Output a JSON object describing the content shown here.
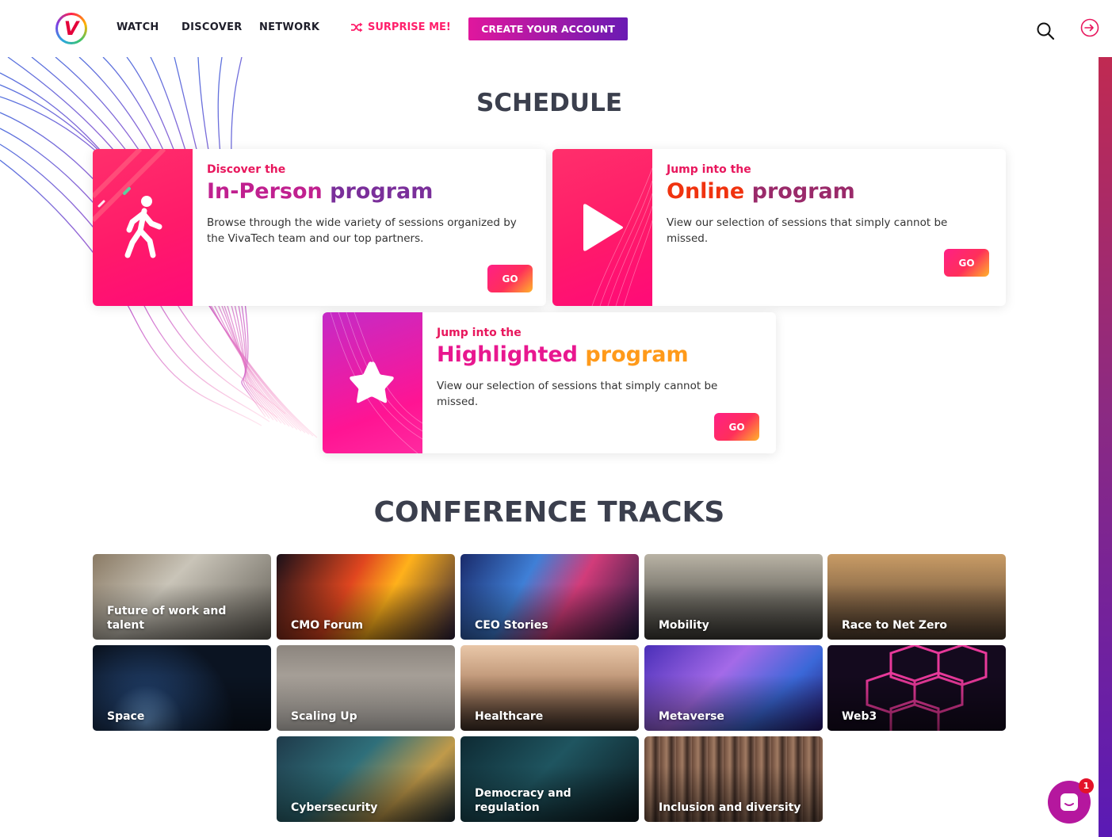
{
  "header": {
    "logo_letter": "V",
    "nav": [
      "WATCH",
      "DISCOVER",
      "NETWORK"
    ],
    "surprise_label": "SURPRISE ME!",
    "create_account_label": "CREATE YOUR ACCOUNT"
  },
  "schedule": {
    "title": "SCHEDULE",
    "cards": [
      {
        "kicker": "Discover the",
        "title_word1": "In-Person",
        "title_word2": "program",
        "description": "Browse through the wide variety of sessions organized by the VivaTech team and our top partners.",
        "button": "GO"
      },
      {
        "kicker": "Jump into the",
        "title_word1": "Online",
        "title_word2": "program",
        "description": "View our selection of sessions that simply cannot be missed.",
        "button": "GO"
      },
      {
        "kicker": "Jump into the",
        "title_word1": "Highlighted",
        "title_word2": "program",
        "description": "View our selection of sessions that simply cannot be missed.",
        "button": "GO"
      }
    ]
  },
  "tracks": {
    "title": "CONFERENCE TRACKS",
    "items": [
      "Future of work and talent",
      "CMO Forum",
      "CEO Stories",
      "Mobility",
      "Race to Net Zero",
      "Space",
      "Scaling Up",
      "Healthcare",
      "Metaverse",
      "Web3",
      "Cybersecurity",
      "Democracy and regulation",
      "Inclusion and diversity"
    ]
  },
  "chat": {
    "badge_count": "1"
  },
  "colors": {
    "accent_pink": "#ff1f6b",
    "accent_purple": "#6a1bb3",
    "title_gray": "#3b3f4d"
  }
}
